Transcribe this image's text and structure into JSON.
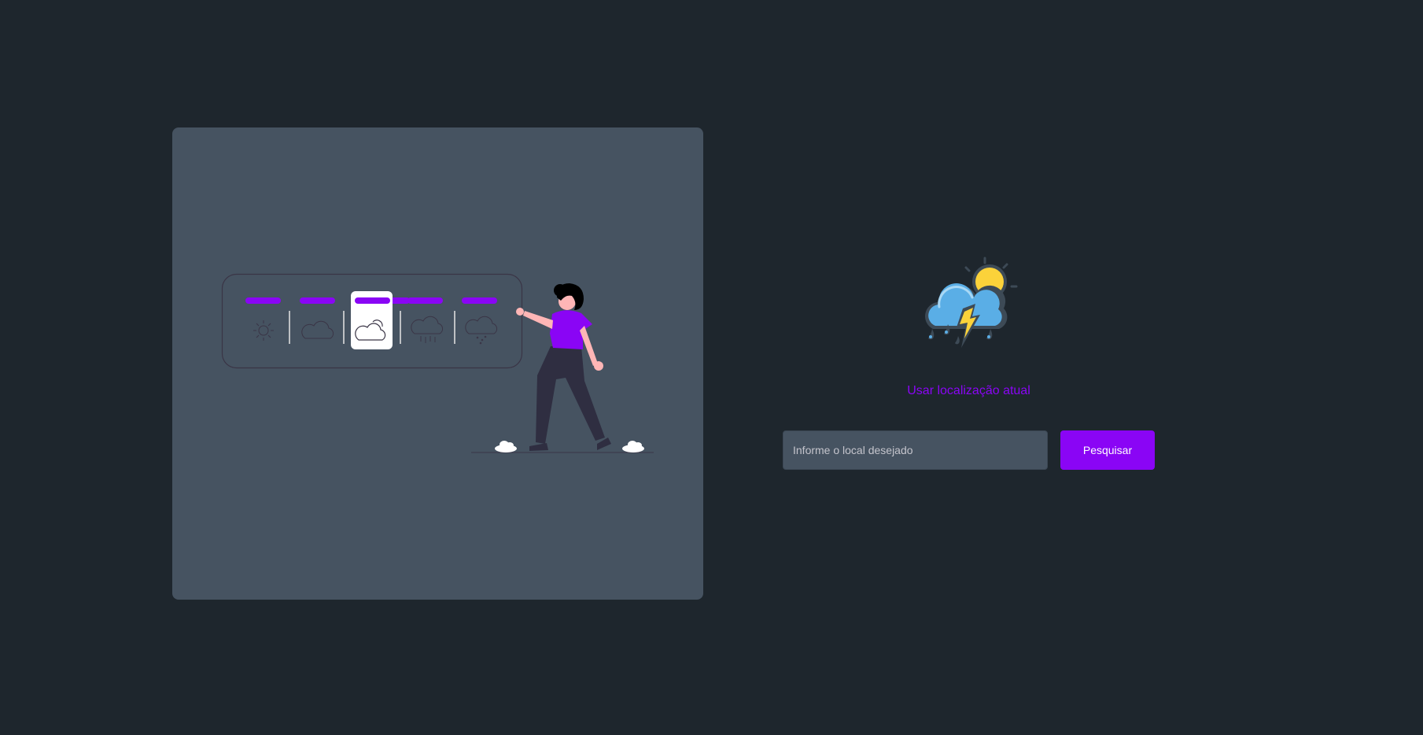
{
  "illustration": {
    "description_icon": "woman-with-weather-board-illustration",
    "forecast_slots": [
      {
        "icon": "sun-icon"
      },
      {
        "icon": "cloud-icon"
      },
      {
        "icon": "partly-cloudy-icon",
        "selected": true
      },
      {
        "icon": "rain-icon"
      },
      {
        "icon": "drizzle-icon"
      }
    ],
    "colors": {
      "accent": "#8a05f5",
      "card": "#465361",
      "board_outline": "#3a3546",
      "figure_skin": "#ffb6b6",
      "figure_pants": "#2f2e41"
    }
  },
  "logo": {
    "icon": "storm-cloud-sun-icon"
  },
  "location": {
    "label": "Usar localização atual"
  },
  "search": {
    "placeholder": "Informe o local desejado",
    "value": "",
    "button_label": "Pesquisar"
  },
  "colors": {
    "background": "#1e262d",
    "accent": "#8a05f5",
    "input_bg": "#465361"
  }
}
